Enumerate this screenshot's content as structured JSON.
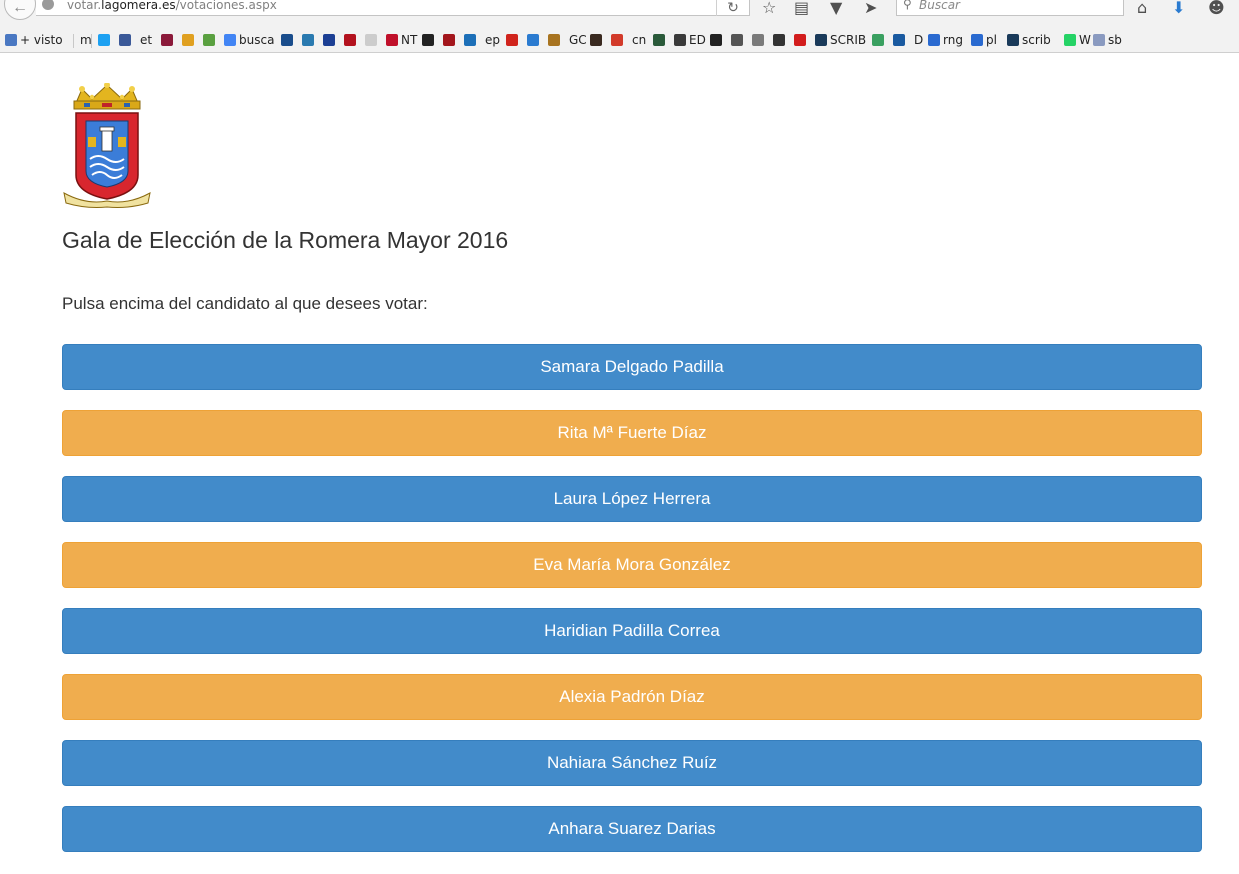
{
  "browser": {
    "url_prefix": "votar.",
    "url_host": "lagomera.es",
    "url_path": "/votaciones.aspx",
    "search_placeholder": "Buscar"
  },
  "bookmarks": [
    {
      "label": "+ visto",
      "icon_color": "#4a78c2",
      "icon": "reader-icon"
    },
    {
      "label": "m",
      "icon_color": "",
      "icon": ""
    },
    {
      "label": "",
      "icon_color": "#1da1f2",
      "icon": "twitter-icon"
    },
    {
      "label": "",
      "icon_color": "#3b5998",
      "icon": "facebook-icon"
    },
    {
      "label": "et",
      "icon_color": "",
      "icon": ""
    },
    {
      "label": "",
      "icon_color": "#8b1a3a",
      "icon": "bookmark-icon"
    },
    {
      "label": "",
      "icon_color": "#e0a020",
      "icon": "bookmark-icon"
    },
    {
      "label": "",
      "icon_color": "#5aa040",
      "icon": "bookmark-icon"
    },
    {
      "label": "busca",
      "icon_color": "#4285f4",
      "icon": "google-icon"
    },
    {
      "label": "",
      "icon_color": "#1a4d8c",
      "icon": "bookmark-icon"
    },
    {
      "label": "",
      "icon_color": "#2a7ab0",
      "icon": "bookmark-icon"
    },
    {
      "label": "",
      "icon_color": "#1c3f94",
      "icon": "bookmark-icon"
    },
    {
      "label": "",
      "icon_color": "#b3121e",
      "icon": "bookmark-icon"
    },
    {
      "label": "",
      "icon_color": "#cccccc",
      "icon": "bookmark-icon"
    },
    {
      "label": "NT",
      "icon_color": "#c0102a",
      "icon": "bookmark-icon"
    },
    {
      "label": "",
      "icon_color": "#222222",
      "icon": "bookmark-icon"
    },
    {
      "label": "",
      "icon_color": "#a3161c",
      "icon": "bookmark-icon"
    },
    {
      "label": "",
      "icon_color": "#1c6fb8",
      "icon": "bookmark-icon"
    },
    {
      "label": "ep",
      "icon_color": "",
      "icon": ""
    },
    {
      "label": "",
      "icon_color": "#d0241c",
      "icon": "bookmark-icon"
    },
    {
      "label": "",
      "icon_color": "#2b7bd0",
      "icon": "bookmark-icon"
    },
    {
      "label": "",
      "icon_color": "#a87420",
      "icon": "bookmark-icon"
    },
    {
      "label": "GC",
      "icon_color": "",
      "icon": ""
    },
    {
      "label": "",
      "icon_color": "#3a2a20",
      "icon": "bookmark-icon"
    },
    {
      "label": "",
      "icon_color": "#d23a2a",
      "icon": "bookmark-icon"
    },
    {
      "label": "cn",
      "icon_color": "",
      "icon": ""
    },
    {
      "label": "",
      "icon_color": "#2a5a3a",
      "icon": "bookmark-icon"
    },
    {
      "label": "ED",
      "icon_color": "#3a3a3a",
      "icon": "bookmark-icon"
    },
    {
      "label": "",
      "icon_color": "#222222",
      "icon": "bookmark-icon"
    },
    {
      "label": "",
      "icon_color": "#555555",
      "icon": "bookmark-icon"
    },
    {
      "label": "",
      "icon_color": "#7a7a7a",
      "icon": "bookmark-icon"
    },
    {
      "label": "",
      "icon_color": "#333333",
      "icon": "bookmark-icon"
    },
    {
      "label": "",
      "icon_color": "#d21c1c",
      "icon": "bookmark-icon"
    },
    {
      "label": "SCRIB",
      "icon_color": "#1a3a5a",
      "icon": "bookmark-icon"
    },
    {
      "label": "",
      "icon_color": "#3aa060",
      "icon": "bookmark-icon"
    },
    {
      "label": "",
      "icon_color": "#1a5aa0",
      "icon": "bookmark-icon"
    },
    {
      "label": "D",
      "icon_color": "",
      "icon": ""
    },
    {
      "label": "rng",
      "icon_color": "#2a6ad0",
      "icon": "bookmark-icon"
    },
    {
      "label": "pl",
      "icon_color": "#2a6ad0",
      "icon": "bookmark-icon"
    },
    {
      "label": "scrib",
      "icon_color": "#1a3a5a",
      "icon": "bookmark-icon"
    },
    {
      "label": "W",
      "icon_color": "#25d366",
      "icon": "whatsapp-icon"
    },
    {
      "label": "sb",
      "icon_color": "#8a9ac0",
      "icon": "bookmark-icon"
    }
  ],
  "page": {
    "title": "Gala de Elección de la Romera Mayor 2016",
    "instruction": "Pulsa encima del candidato al que desees votar:"
  },
  "candidates": [
    {
      "name": "Samara Delgado Padilla",
      "style": "primary"
    },
    {
      "name": "Rita Mª Fuerte Díaz",
      "style": "warning"
    },
    {
      "name": "Laura López Herrera",
      "style": "primary"
    },
    {
      "name": "Eva María Mora González",
      "style": "warning"
    },
    {
      "name": "Haridian Padilla Correa",
      "style": "primary"
    },
    {
      "name": "Alexia Padrón Díaz",
      "style": "warning"
    },
    {
      "name": "Nahiara Sánchez Ruíz",
      "style": "primary"
    },
    {
      "name": "Anhara Suarez Darias",
      "style": "primary"
    }
  ],
  "colors": {
    "primary": "#428bca",
    "warning": "#f0ad4e",
    "text": "#333333"
  }
}
